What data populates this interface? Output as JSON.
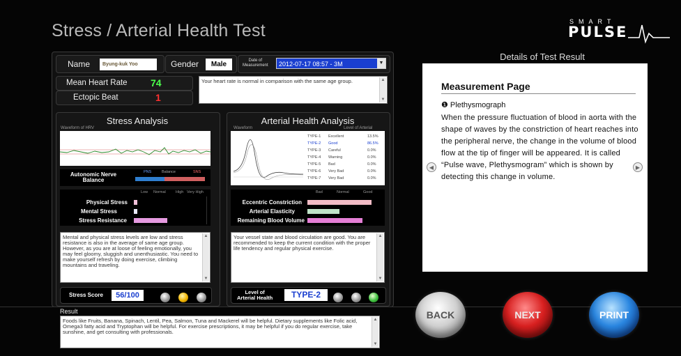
{
  "header": {
    "title": "Stress / Arterial Health Test",
    "logo_top": "SMART",
    "logo_bottom": "PULSE"
  },
  "patient": {
    "name_label": "Name",
    "name_value": "Byung-kuk Yoo",
    "gender_label": "Gender",
    "gender_value": "Male",
    "date_label_line1": "Date of",
    "date_label_line2": "Measurement",
    "date_value": "2012-07-17 08:57 - 3M"
  },
  "heart": {
    "mean_label": "Mean Heart Rate",
    "mean_value": "74",
    "ectopic_label": "Ectopic Beat",
    "ectopic_value": "1",
    "comment": "Your heart rate is normal in comparison with the same age group."
  },
  "stress": {
    "title": "Stress Analysis",
    "waveform_label": "Waveform of HRV",
    "ans_label_line1": "Autonomic Nerve",
    "ans_label_line2": "Balance",
    "pns": "PNS",
    "balance": "Balance",
    "sns": "SNS",
    "scale": [
      "Low",
      "Normal",
      "High",
      "Very High"
    ],
    "rows": [
      {
        "label": "Physical Stress",
        "level": 0.05
      },
      {
        "label": "Mental Stress",
        "level": 0.05
      },
      {
        "label": "Stress Resistance",
        "level": 0.48
      }
    ],
    "comment": "Mental and physical stress levels are low and stress resistance is also in the average of same age group. However, as you are at loose of feeling emotionally, you may feel gloomy, sluggish and unenthusiastic. You need to make yourself refresh by doing exercise, climbing mountains and traveling.",
    "score_label": "Stress Score",
    "score_value": "56/100"
  },
  "arterial": {
    "title": "Arterial Health Analysis",
    "waveform_label": "Waveform",
    "level_label": "Level of Arterial",
    "types": [
      {
        "type": "TYPE-1",
        "status": "Excellent",
        "pct": "13.5%",
        "highlight": false
      },
      {
        "type": "TYPE-2",
        "status": "Good",
        "pct": "86.5%",
        "highlight": true
      },
      {
        "type": "TYPE-3",
        "status": "Careful",
        "pct": "0.0%",
        "highlight": false
      },
      {
        "type": "TYPE-4",
        "status": "Warning",
        "pct": "0.0%",
        "highlight": false
      },
      {
        "type": "TYPE-5",
        "status": "Bad",
        "pct": "0.0%",
        "highlight": false
      },
      {
        "type": "TYPE-6",
        "status": "Very Bad",
        "pct": "0.0%",
        "highlight": false
      },
      {
        "type": "TYPE-7",
        "status": "Very Bad",
        "pct": "0.0%",
        "highlight": false
      }
    ],
    "scale": [
      "Bad",
      "Normal",
      "Good"
    ],
    "rows": [
      {
        "label": "Eccentric Constriction",
        "level": 0.96,
        "color": "#f2bcc6"
      },
      {
        "label": "Arterial Elasticity",
        "level": 0.48,
        "color": "#bfe3c8"
      },
      {
        "label": "Remaining Blood Volume",
        "level": 0.82,
        "color": "#e57fd6"
      }
    ],
    "comment": "Your vessel state and blood circulation are good. You are recommended to keep the current condition with the proper life tendency and regular physical exercise.",
    "level_label_line1": "Level of",
    "level_label_line2": "Arterial Health",
    "level_value": "TYPE-2"
  },
  "details": {
    "title": "Details of Test Result",
    "page_heading": "Measurement Page",
    "item_heading": "❶ Plethysmograph",
    "body": "When the pressure fluctuation of blood in aorta with the shape of waves by the constriction of heart reaches into the peripheral nerve, the change in the volume of blood flow at the tip of finger will be appeared. It is called “Pulse wave, Plethysmogram” which is shown by detecting this change in volume."
  },
  "result": {
    "label": "Result",
    "text": "Foods like Fruits, Banana, Spinach, Lentil, Pea, Salmon, Tuna and Mackerel will be helpful. Dietary supplements like Folic acid, Omega3 fatty acid and Tryptophan will be helpful. For exercise prescriptions, it may be helpful if you do regular exercise, take sunshine, and get consulting with professionals."
  },
  "buttons": {
    "back": "BACK",
    "next": "NEXT",
    "print": "PRINT"
  },
  "colors": {
    "accent_blue": "#1a3fd0",
    "heart_green": "#4cff4c",
    "ectopic_red": "#ff3030",
    "next_red": "#c81e1e",
    "print_blue": "#1e6fd8"
  }
}
